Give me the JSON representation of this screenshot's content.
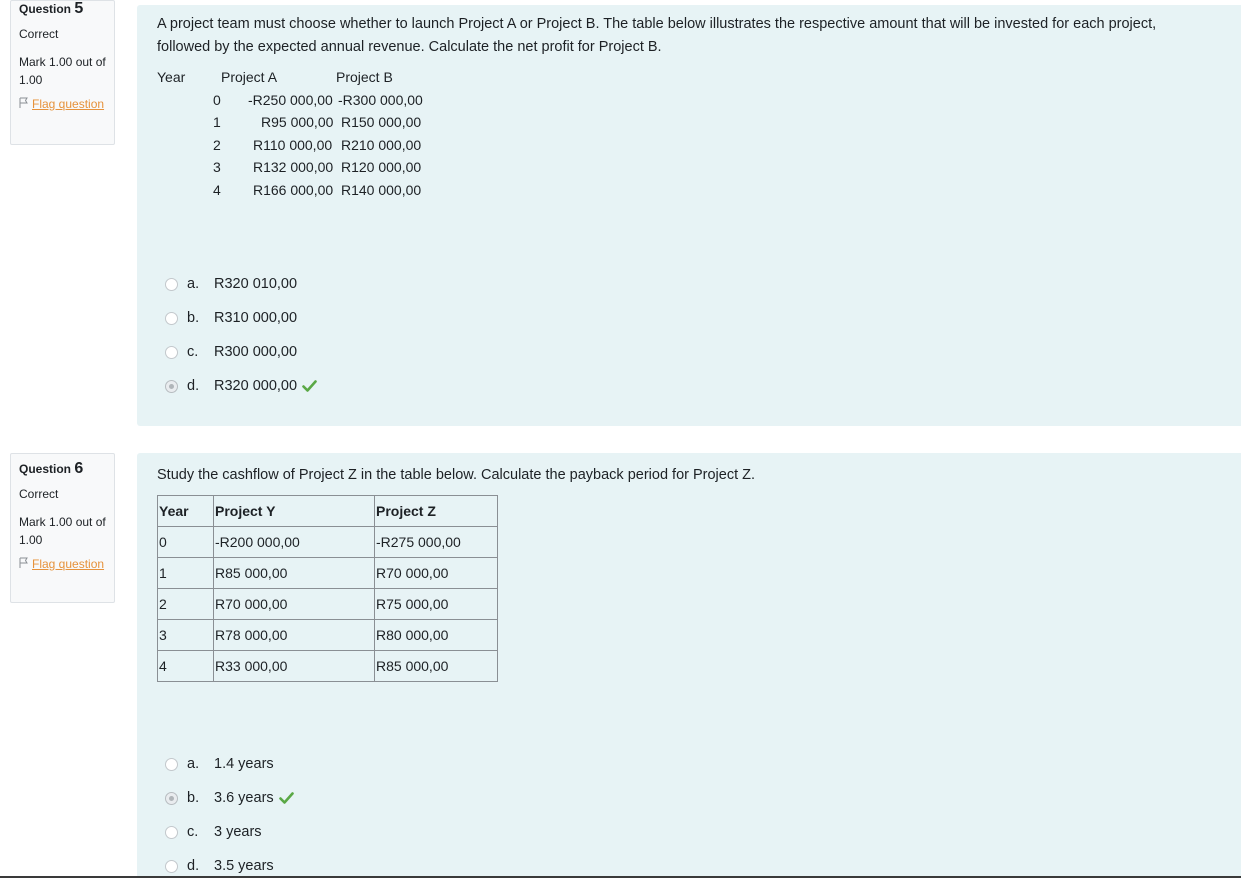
{
  "questions": [
    {
      "label": "Question",
      "number": "5",
      "state": "Correct",
      "grade": "Mark 1.00 out of 1.00",
      "flag_label": "Flag question",
      "text": "A project team must choose whether to launch Project A or Project B. The table below illustrates the respective amount that will be invested for each project, followed by the expected annual revenue. Calculate the net profit for Project B.",
      "table": {
        "headers": [
          "Year",
          "Project A",
          "Project B"
        ],
        "rows": [
          [
            "0",
            "-R250 000,00",
            "-R300 000,00"
          ],
          [
            "1",
            "R95 000,00",
            "R150 000,00"
          ],
          [
            "2",
            "R110 000,00",
            "R210 000,00"
          ],
          [
            "3",
            "R132 000,00",
            "R120 000,00"
          ],
          [
            "4",
            "R166 000,00",
            "R140 000,00"
          ]
        ]
      },
      "answers": [
        {
          "letter": "a.",
          "text": "R320 010,00",
          "selected": false,
          "correct": false
        },
        {
          "letter": "b.",
          "text": "R310 000,00",
          "selected": false,
          "correct": false
        },
        {
          "letter": "c.",
          "text": "R300 000,00",
          "selected": false,
          "correct": false
        },
        {
          "letter": "d.",
          "text": "R320 000,00",
          "selected": true,
          "correct": true
        }
      ]
    },
    {
      "label": "Question",
      "number": "6",
      "state": "Correct",
      "grade": "Mark 1.00 out of 1.00",
      "flag_label": "Flag question",
      "text": "Study the cashflow of Project Z in the table below. Calculate the payback period for Project Z.",
      "table": {
        "headers": [
          "Year",
          "Project Y",
          "Project Z"
        ],
        "rows": [
          [
            "0",
            "-R200 000,00",
            "-R275 000,00"
          ],
          [
            "1",
            "R85 000,00",
            "R70 000,00"
          ],
          [
            "2",
            "R70 000,00",
            "R75 000,00"
          ],
          [
            "3",
            "R78 000,00",
            "R80 000,00"
          ],
          [
            "4",
            "R33 000,00",
            "R85 000,00"
          ]
        ]
      },
      "answers": [
        {
          "letter": "a.",
          "text": "1.4 years",
          "selected": false,
          "correct": false
        },
        {
          "letter": "b.",
          "text": "3.6 years",
          "selected": true,
          "correct": true
        },
        {
          "letter": "c.",
          "text": "3 years",
          "selected": false,
          "correct": false
        },
        {
          "letter": "d.",
          "text": "3.5 years",
          "selected": false,
          "correct": false
        }
      ]
    }
  ],
  "colors": {
    "content_bg": "#e7f3f5",
    "flag_link": "#e6923b",
    "check": "#5aa845"
  },
  "icons": {
    "flag": "flag-icon",
    "correct": "check-icon"
  }
}
